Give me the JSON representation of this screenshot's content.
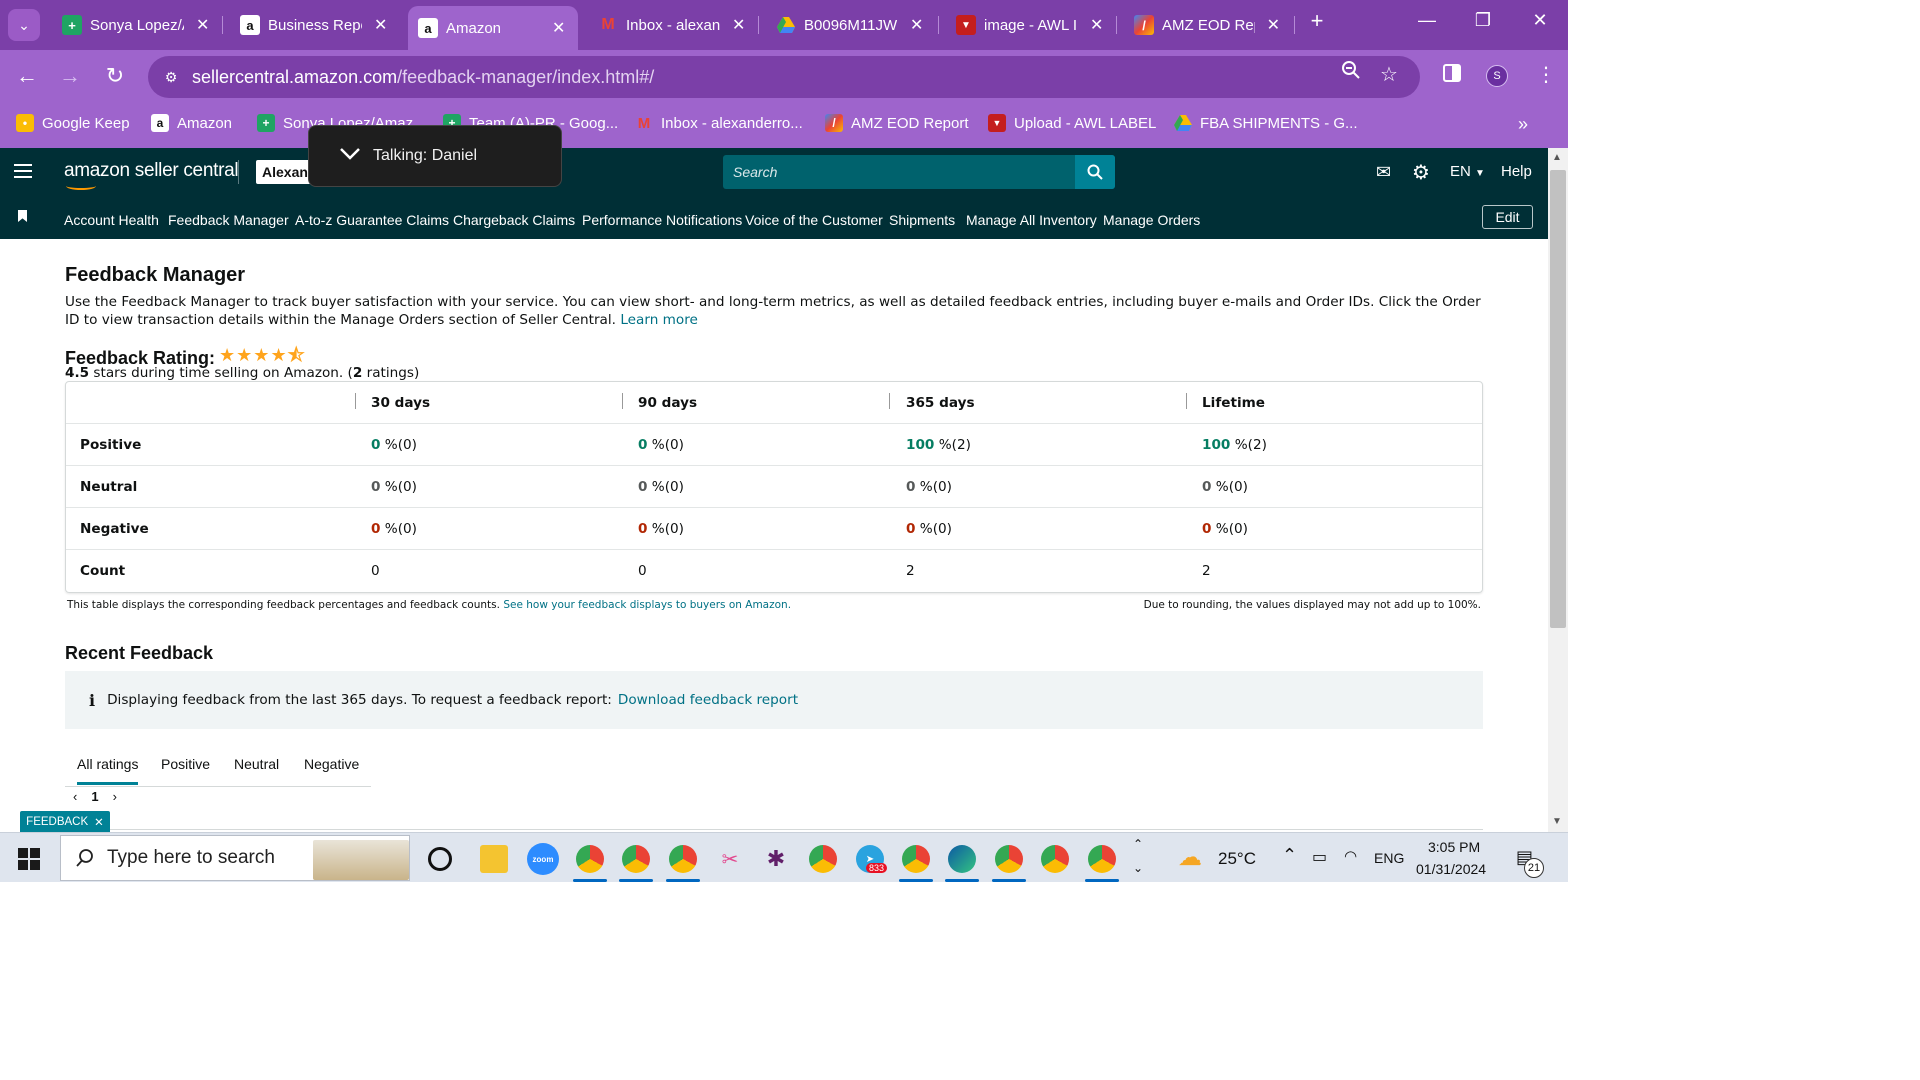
{
  "browser": {
    "tabs": [
      {
        "label": "Sonya Lopez/A",
        "icon": "google-sheets-icon"
      },
      {
        "label": "Business Repo",
        "icon": "amazon-icon"
      },
      {
        "label": "Amazon",
        "icon": "amazon-icon",
        "active": true
      },
      {
        "label": "Inbox - alexan",
        "icon": "gmail-icon"
      },
      {
        "label": "B0096M11JW",
        "icon": "google-drive-icon"
      },
      {
        "label": "image - AWL I",
        "icon": "awl-icon"
      },
      {
        "label": "AMZ EOD Rep",
        "icon": "eod-icon"
      }
    ],
    "url_domain": "sellercentral.amazon.com",
    "url_path": "/feedback-manager/index.html#/",
    "profile_initial": "S",
    "bookmarks": [
      {
        "label": "Google Keep",
        "icon": "google-keep-icon"
      },
      {
        "label": "Amazon",
        "icon": "amazon-icon"
      },
      {
        "label": "Sonya Lopez/Amaz...",
        "icon": "google-sheets-icon"
      },
      {
        "label": "Team (A)-PR - Goog...",
        "icon": "google-sheets-icon"
      },
      {
        "label": "Inbox - alexanderro...",
        "icon": "gmail-icon"
      },
      {
        "label": "AMZ EOD Report",
        "icon": "eod-icon"
      },
      {
        "label": "Upload - AWL LABEL",
        "icon": "awl-icon"
      },
      {
        "label": "FBA SHIPMENTS - G...",
        "icon": "google-drive-icon"
      }
    ]
  },
  "popup": {
    "text": "Talking: Daniel"
  },
  "header": {
    "logo": "amazon seller central",
    "account": "Alexand",
    "search_placeholder": "Search",
    "language": "EN",
    "help": "Help"
  },
  "nav": {
    "links": [
      "Account Health",
      "Feedback Manager",
      "A-to-z Guarantee Claims",
      "Chargeback Claims",
      "Performance Notifications",
      "Voice of the Customer",
      "Shipments",
      "Manage All Inventory",
      "Manage Orders"
    ],
    "edit": "Edit"
  },
  "page": {
    "title": "Feedback Manager",
    "intro": "Use the Feedback Manager to track buyer satisfaction with your service. You can view short- and long-term metrics, as well as detailed feedback entries, including buyer e-mails and Order IDs. Click the Order ID to view transaction details within the Manage Orders section of Seller Central.",
    "learn_more": "Learn more",
    "rating_label": "Feedback Rating:",
    "rating_value": "4.5",
    "rating_sub_mid": " stars during time selling on Amazon. (",
    "rating_count": "2",
    "rating_sub_end": " ratings)",
    "table": {
      "headers": [
        "30 days",
        "90 days",
        "365 days",
        "Lifetime"
      ],
      "rows": [
        {
          "label": "Positive",
          "cells": [
            [
              "0",
              "%(0)"
            ],
            [
              "0",
              "%(0)"
            ],
            [
              "100",
              "%(2)"
            ],
            [
              "100",
              "%(2)"
            ]
          ]
        },
        {
          "label": "Neutral",
          "cells": [
            [
              "0",
              "%(0)"
            ],
            [
              "0",
              "%(0)"
            ],
            [
              "0",
              "%(0)"
            ],
            [
              "0",
              "%(0)"
            ]
          ]
        },
        {
          "label": "Negative",
          "cells": [
            [
              "0",
              "%(0)"
            ],
            [
              "0",
              "%(0)"
            ],
            [
              "0",
              "%(0)"
            ],
            [
              "0",
              "%(0)"
            ]
          ]
        },
        {
          "label": "Count",
          "cells": [
            [
              "0",
              ""
            ],
            [
              "0",
              ""
            ],
            [
              "2",
              ""
            ],
            [
              "2",
              ""
            ]
          ]
        }
      ]
    },
    "table_note": "This table displays the corresponding feedback percentages and feedback counts.",
    "table_note_link": "See how your feedback displays to buyers on Amazon.",
    "rounding_note": "Due to rounding, the values displayed may not add up to 100%.",
    "recent_title": "Recent Feedback",
    "info_text": "Displaying feedback from the last 365 days. To request a feedback report:",
    "info_link": "Download feedback report",
    "rating_tabs": [
      "All ratings",
      "Positive",
      "Neutral",
      "Negative"
    ],
    "current_page": "1",
    "feedback_tab": "FEEDBACK"
  },
  "taskbar": {
    "search_placeholder": "Type here to search",
    "weather": "25°C",
    "lang": "ENG",
    "time": "3:05 PM",
    "date": "01/31/2024",
    "notif_count": "21",
    "telegram_badge": "833",
    "zoom_label": "zoom"
  }
}
